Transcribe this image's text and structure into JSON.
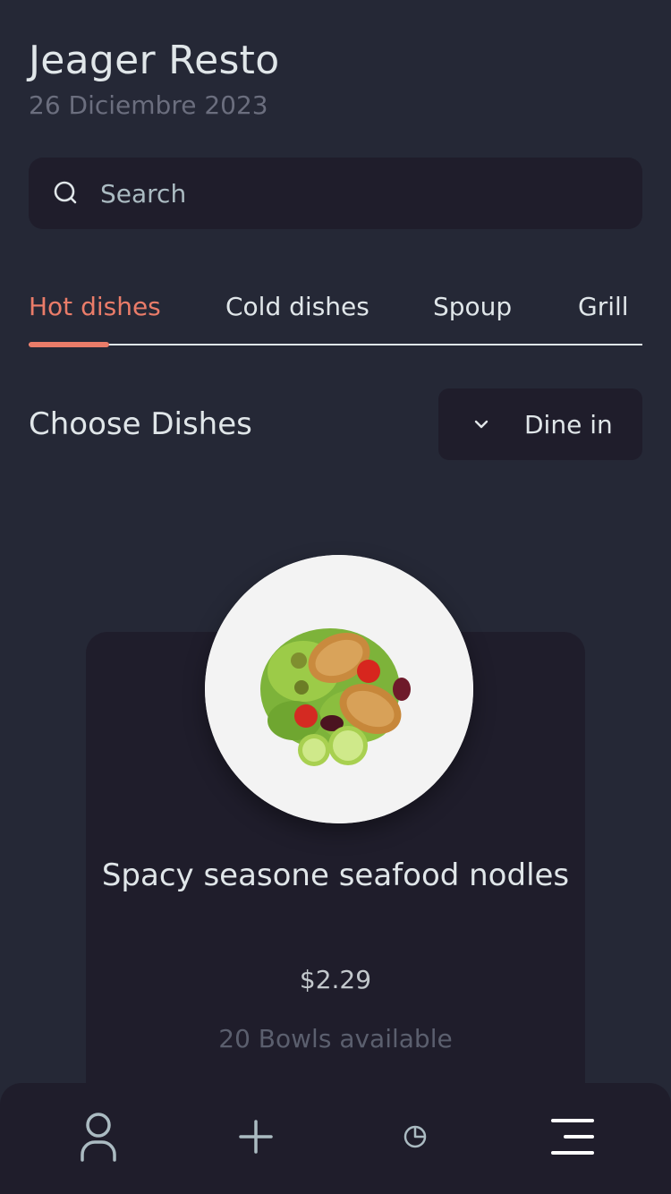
{
  "header": {
    "title": "Jeager Resto",
    "date": "26 Diciembre 2023"
  },
  "search": {
    "placeholder": "Search",
    "icon": "search-icon"
  },
  "tabs": [
    {
      "label": "Hot dishes",
      "active": true
    },
    {
      "label": "Cold dishes",
      "active": false
    },
    {
      "label": "Spoup",
      "active": false
    },
    {
      "label": "Grill",
      "active": false
    }
  ],
  "section": {
    "title": "Choose Dishes",
    "order_type": "Dine in",
    "order_icon": "chevron-down-icon"
  },
  "dish": {
    "name": "Spacy seasone seafood nodles",
    "price": "$2.29",
    "availability": "20 Bowls available"
  },
  "bottom_nav": {
    "items": [
      "user-icon",
      "plus-icon",
      "pie-chart-icon",
      "menu-icon"
    ]
  },
  "colors": {
    "background": "#252836",
    "surface": "#1F1D2B",
    "accent": "#EA7C69",
    "text": "#E0E6E9",
    "muted": "#6B6E7E"
  }
}
